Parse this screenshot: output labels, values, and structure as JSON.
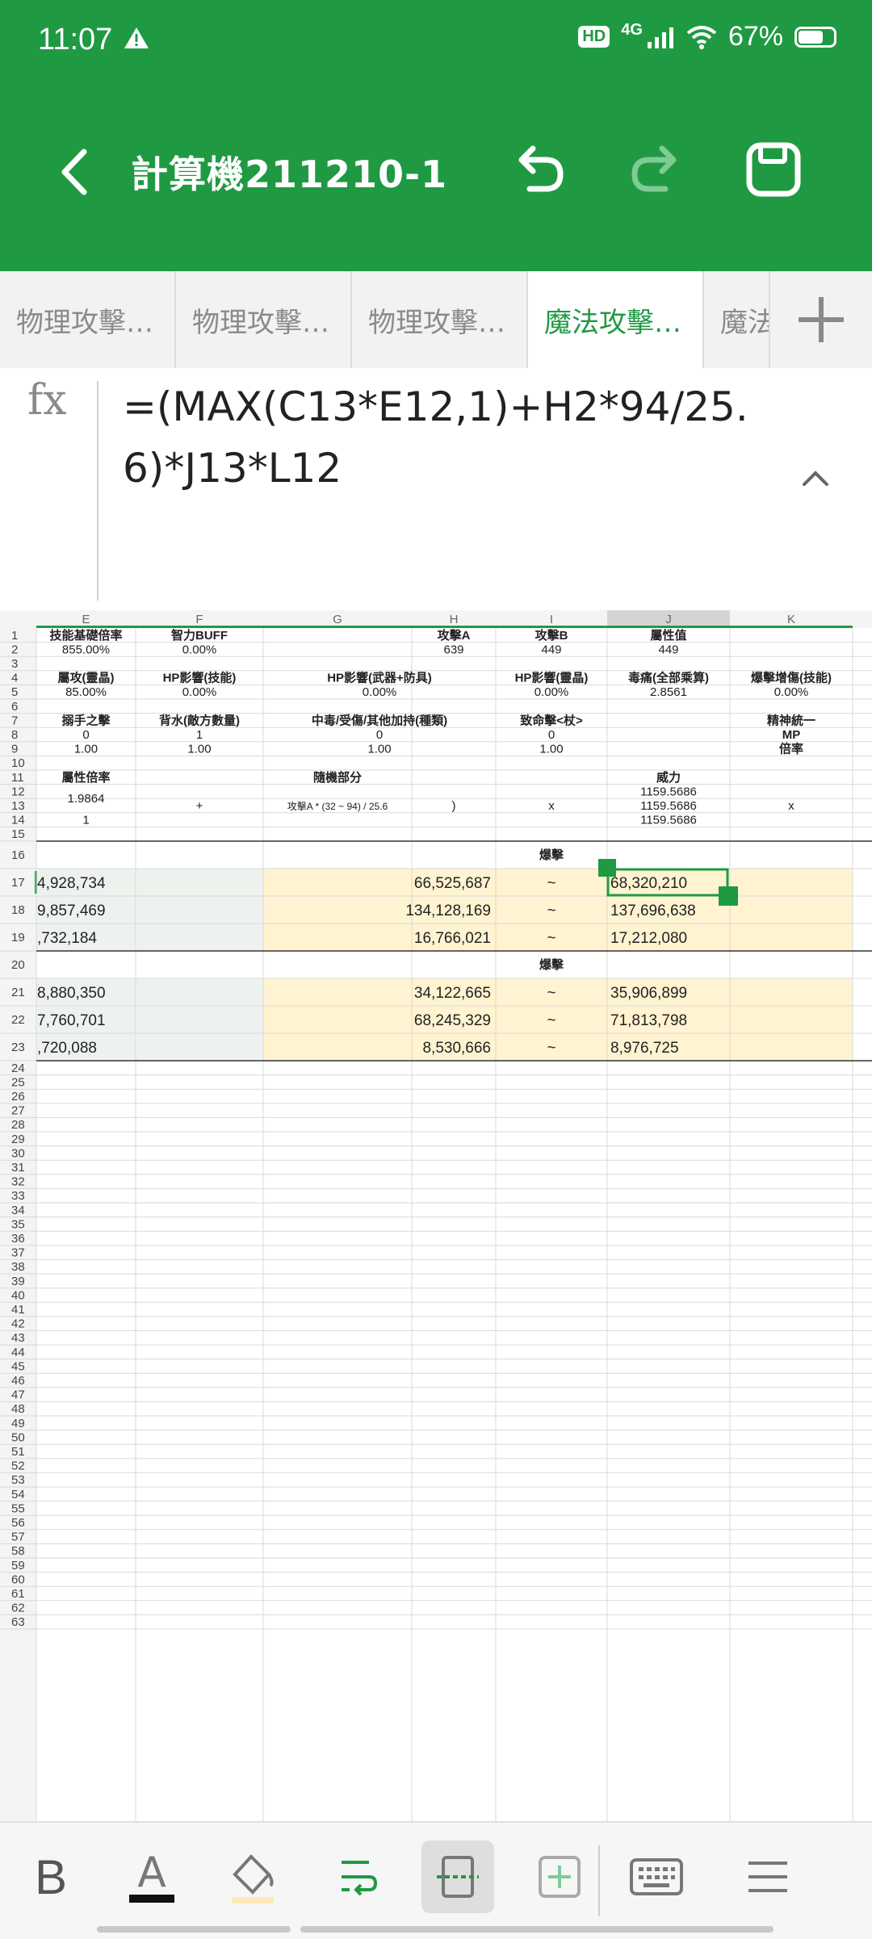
{
  "status": {
    "time": "11:07",
    "network": "4G",
    "battery": "67%",
    "hd": "HD"
  },
  "app": {
    "title": "計算機211210-1"
  },
  "tabs": [
    "物理攻擊…",
    "物理攻擊…",
    "物理攻擊…",
    "魔法攻擊…",
    "魔法"
  ],
  "formula_bar": {
    "label": "fx",
    "formula": "=(MAX(C13*E12,1)+H2*94/25.6)*J13*L12"
  },
  "sheet": {
    "columns": [
      "E",
      "F",
      "G",
      "H",
      "I",
      "J",
      "K"
    ],
    "selected_column": "J",
    "row_numbers": [
      "1",
      "2",
      "3",
      "4",
      "5",
      "6",
      "7",
      "8",
      "9",
      "10",
      "11",
      "12",
      "13",
      "14",
      "15",
      "16",
      "17",
      "18",
      "19",
      "20",
      "21",
      "22",
      "23",
      "24",
      "25",
      "26",
      "27",
      "28",
      "29",
      "30",
      "31",
      "32",
      "33",
      "34",
      "35",
      "36",
      "37",
      "38",
      "39",
      "40",
      "41",
      "42",
      "43",
      "44",
      "45",
      "46",
      "47",
      "48",
      "49",
      "50",
      "51",
      "52",
      "53",
      "54",
      "55",
      "56",
      "57",
      "58",
      "59",
      "60",
      "61",
      "62",
      "63"
    ],
    "cells": {
      "E1": "技能基礎倍率",
      "F1": "智力BUFF",
      "H1": "攻擊A",
      "I1": "攻擊B",
      "J1": "屬性值",
      "E2": "855.00%",
      "F2": "0.00%",
      "H2": "639",
      "I2": "449",
      "J2": "449",
      "E4": "屬攻(靈晶)",
      "F4": "HP影響(技能)",
      "G4": "HP影響(武器+防具)",
      "I4": "HP影響(靈晶)",
      "J4": "毒痛(全部乘算)",
      "K4": "爆擊增傷(技能)",
      "E5": "85.00%",
      "F5": "0.00%",
      "G5": "0.00%",
      "I5": "0.00%",
      "J5": "2.8561",
      "K5": "0.00%",
      "E7": "搦手之擊",
      "F7": "背水(敵方數量)",
      "G7": "中毒/受傷/其他加持(種類)",
      "I7": "致命擊<杖>",
      "K7": "精神統一",
      "E8": "0",
      "F8": "1",
      "G8": "0",
      "I8": "0",
      "K8": "MP",
      "E9": "1.00",
      "F9": "1.00",
      "G9": "1.00",
      "I9": "1.00",
      "K9": "倍率",
      "E11": "屬性倍率",
      "G11": "隨機部分",
      "J11": "威力",
      "E12": "1.9864",
      "F12": "+",
      "G12": "攻擊A * (32 ~ 94) / 25.6",
      "H12": ")",
      "I12": "x",
      "K12": "x",
      "J12": "1159.5686",
      "J13": "1159.5686",
      "J14": "1159.5686",
      "E14": "1",
      "I16": "爆擊",
      "E17": "4,928,734",
      "H17": "66,525,687",
      "I17": "~",
      "J17": "68,320,210",
      "E18": "9,857,469",
      "H18": "134,128,169",
      "I18": "~",
      "J18": "137,696,638",
      "E19": ",732,184",
      "H19": "16,766,021",
      "I19": "~",
      "J19": "17,212,080",
      "I20": "爆擊",
      "E21": "8,880,350",
      "H21": "34,122,665",
      "I21": "~",
      "J21": "35,906,899",
      "E22": "7,760,701",
      "H22": "68,245,329",
      "I22": "~",
      "J22": "71,813,798",
      "E23": ",720,088",
      "H23": "8,530,666",
      "I23": "~",
      "J23": "8,976,725"
    },
    "selected_cell": "J17",
    "colors": {
      "accent": "#1f9a43",
      "cream_fill": "#fff3d1",
      "gray_fill": "#eef2ee",
      "grid": "#d9d9d9"
    }
  },
  "toolbar": {
    "items": [
      "bold-icon",
      "font-color-icon",
      "fill-color-icon",
      "wrap-text-icon",
      "cell-border-icon",
      "insert-cell-icon",
      "keyboard-icon",
      "menu-icon"
    ],
    "bold_label": "B",
    "font_color_label": "A"
  }
}
